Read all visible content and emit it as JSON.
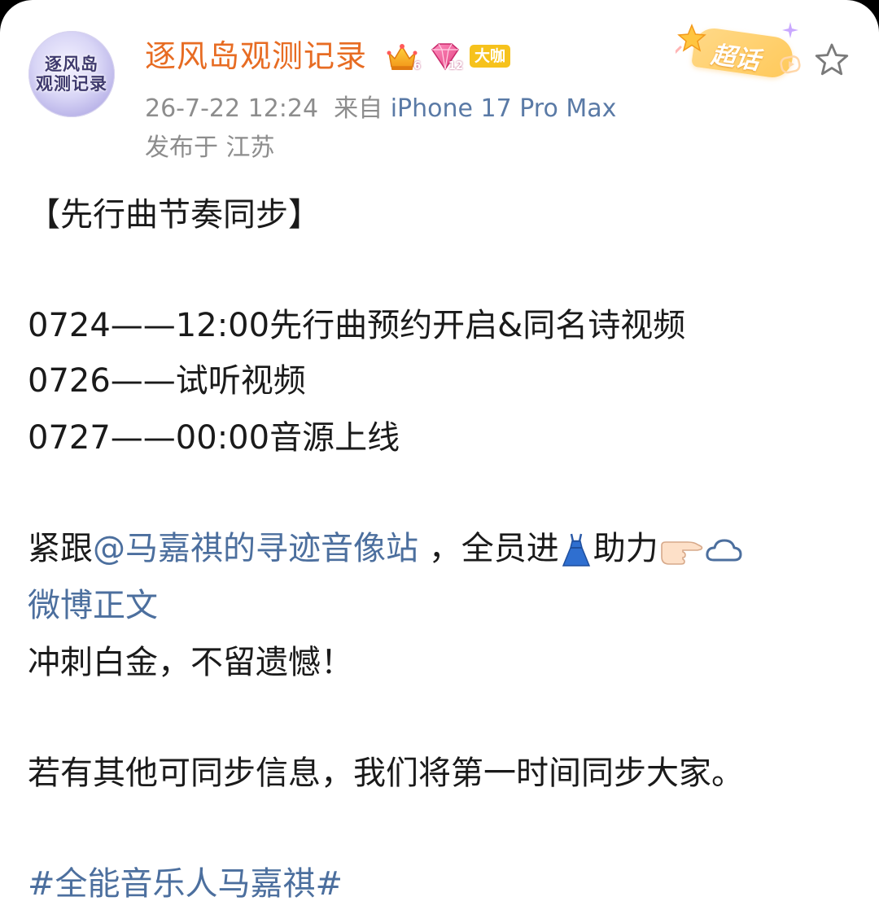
{
  "author": {
    "avatar_text": "逐风岛\n观测记录",
    "name": "逐风岛观测记录",
    "badges": {
      "crown_level": "6",
      "gem_level": "12",
      "daka_label": "大咖"
    }
  },
  "meta": {
    "timestamp": "26-7-22 12:24",
    "source_prefix": "来自",
    "device": "iPhone 17 Pro Max",
    "location": "发布于 江苏"
  },
  "supertopic": {
    "label": "超话"
  },
  "icons": {
    "favorite": "star-outline-icon",
    "dress": "dress-emoji-icon",
    "pointing": "pointing-right-emoji-icon",
    "weibo_link": "weibo-cloud-icon"
  },
  "post": {
    "title": "【先行曲节奏同步】",
    "schedule": [
      {
        "date": "0724",
        "dash": "——",
        "text": "12:00先行曲预约开启&同名诗视频"
      },
      {
        "date": "0726",
        "dash": "——",
        "text": "试听视频"
      },
      {
        "date": "0727",
        "dash": "——",
        "text": "00:00音源上线"
      }
    ],
    "follow_prefix": "紧跟",
    "mention": "@马嘉祺的寻迹音像站",
    "follow_middle": " ，全员进",
    "follow_suffix": "助力",
    "weibo_link": "微博正文",
    "cheer": "冲刺白金，不留遗憾！",
    "notice": "若有其他可同步信息，我们将第一时间同步大家。",
    "hashtag": "#全能音乐人马嘉祺#"
  }
}
